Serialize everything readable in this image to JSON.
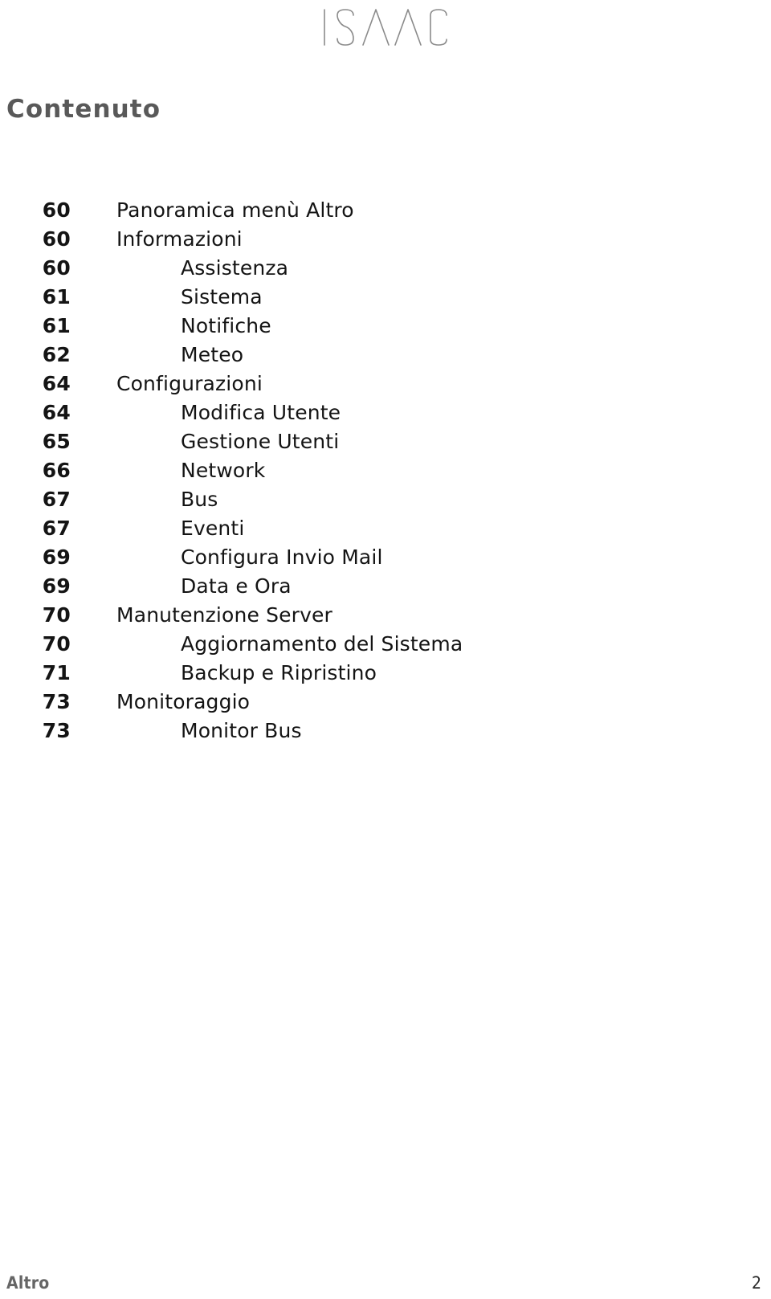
{
  "logo": {
    "text": "ISAAC",
    "color": "#8a8a8a"
  },
  "heading": {
    "title": "Contenuto"
  },
  "toc": {
    "entries": [
      {
        "page": "60",
        "label": "Panoramica menù Altro",
        "level": 1
      },
      {
        "page": "60",
        "label": "Informazioni",
        "level": 1
      },
      {
        "page": "60",
        "label": "Assistenza",
        "level": 2
      },
      {
        "page": "61",
        "label": "Sistema",
        "level": 2
      },
      {
        "page": "61",
        "label": "Notifiche",
        "level": 2
      },
      {
        "page": "62",
        "label": "Meteo",
        "level": 2
      },
      {
        "page": "64",
        "label": "Configurazioni",
        "level": 1
      },
      {
        "page": "64",
        "label": "Modifica Utente",
        "level": 2
      },
      {
        "page": "65",
        "label": "Gestione Utenti",
        "level": 2
      },
      {
        "page": "66",
        "label": "Network",
        "level": 2
      },
      {
        "page": "67",
        "label": "Bus",
        "level": 2
      },
      {
        "page": "67",
        "label": "Eventi",
        "level": 2
      },
      {
        "page": "69",
        "label": "Configura Invio Mail",
        "level": 2
      },
      {
        "page": "69",
        "label": "Data e Ora",
        "level": 2
      },
      {
        "page": "70",
        "label": "Manutenzione Server",
        "level": 1
      },
      {
        "page": "70",
        "label": "Aggiornamento del Sistema",
        "level": 2
      },
      {
        "page": "71",
        "label": "Backup e Ripristino",
        "level": 2
      },
      {
        "page": "73",
        "label": "Monitoraggio",
        "level": 1
      },
      {
        "page": "73",
        "label": "Monitor Bus",
        "level": 2
      }
    ]
  },
  "footer": {
    "section": "Altro",
    "page_number": "2"
  }
}
